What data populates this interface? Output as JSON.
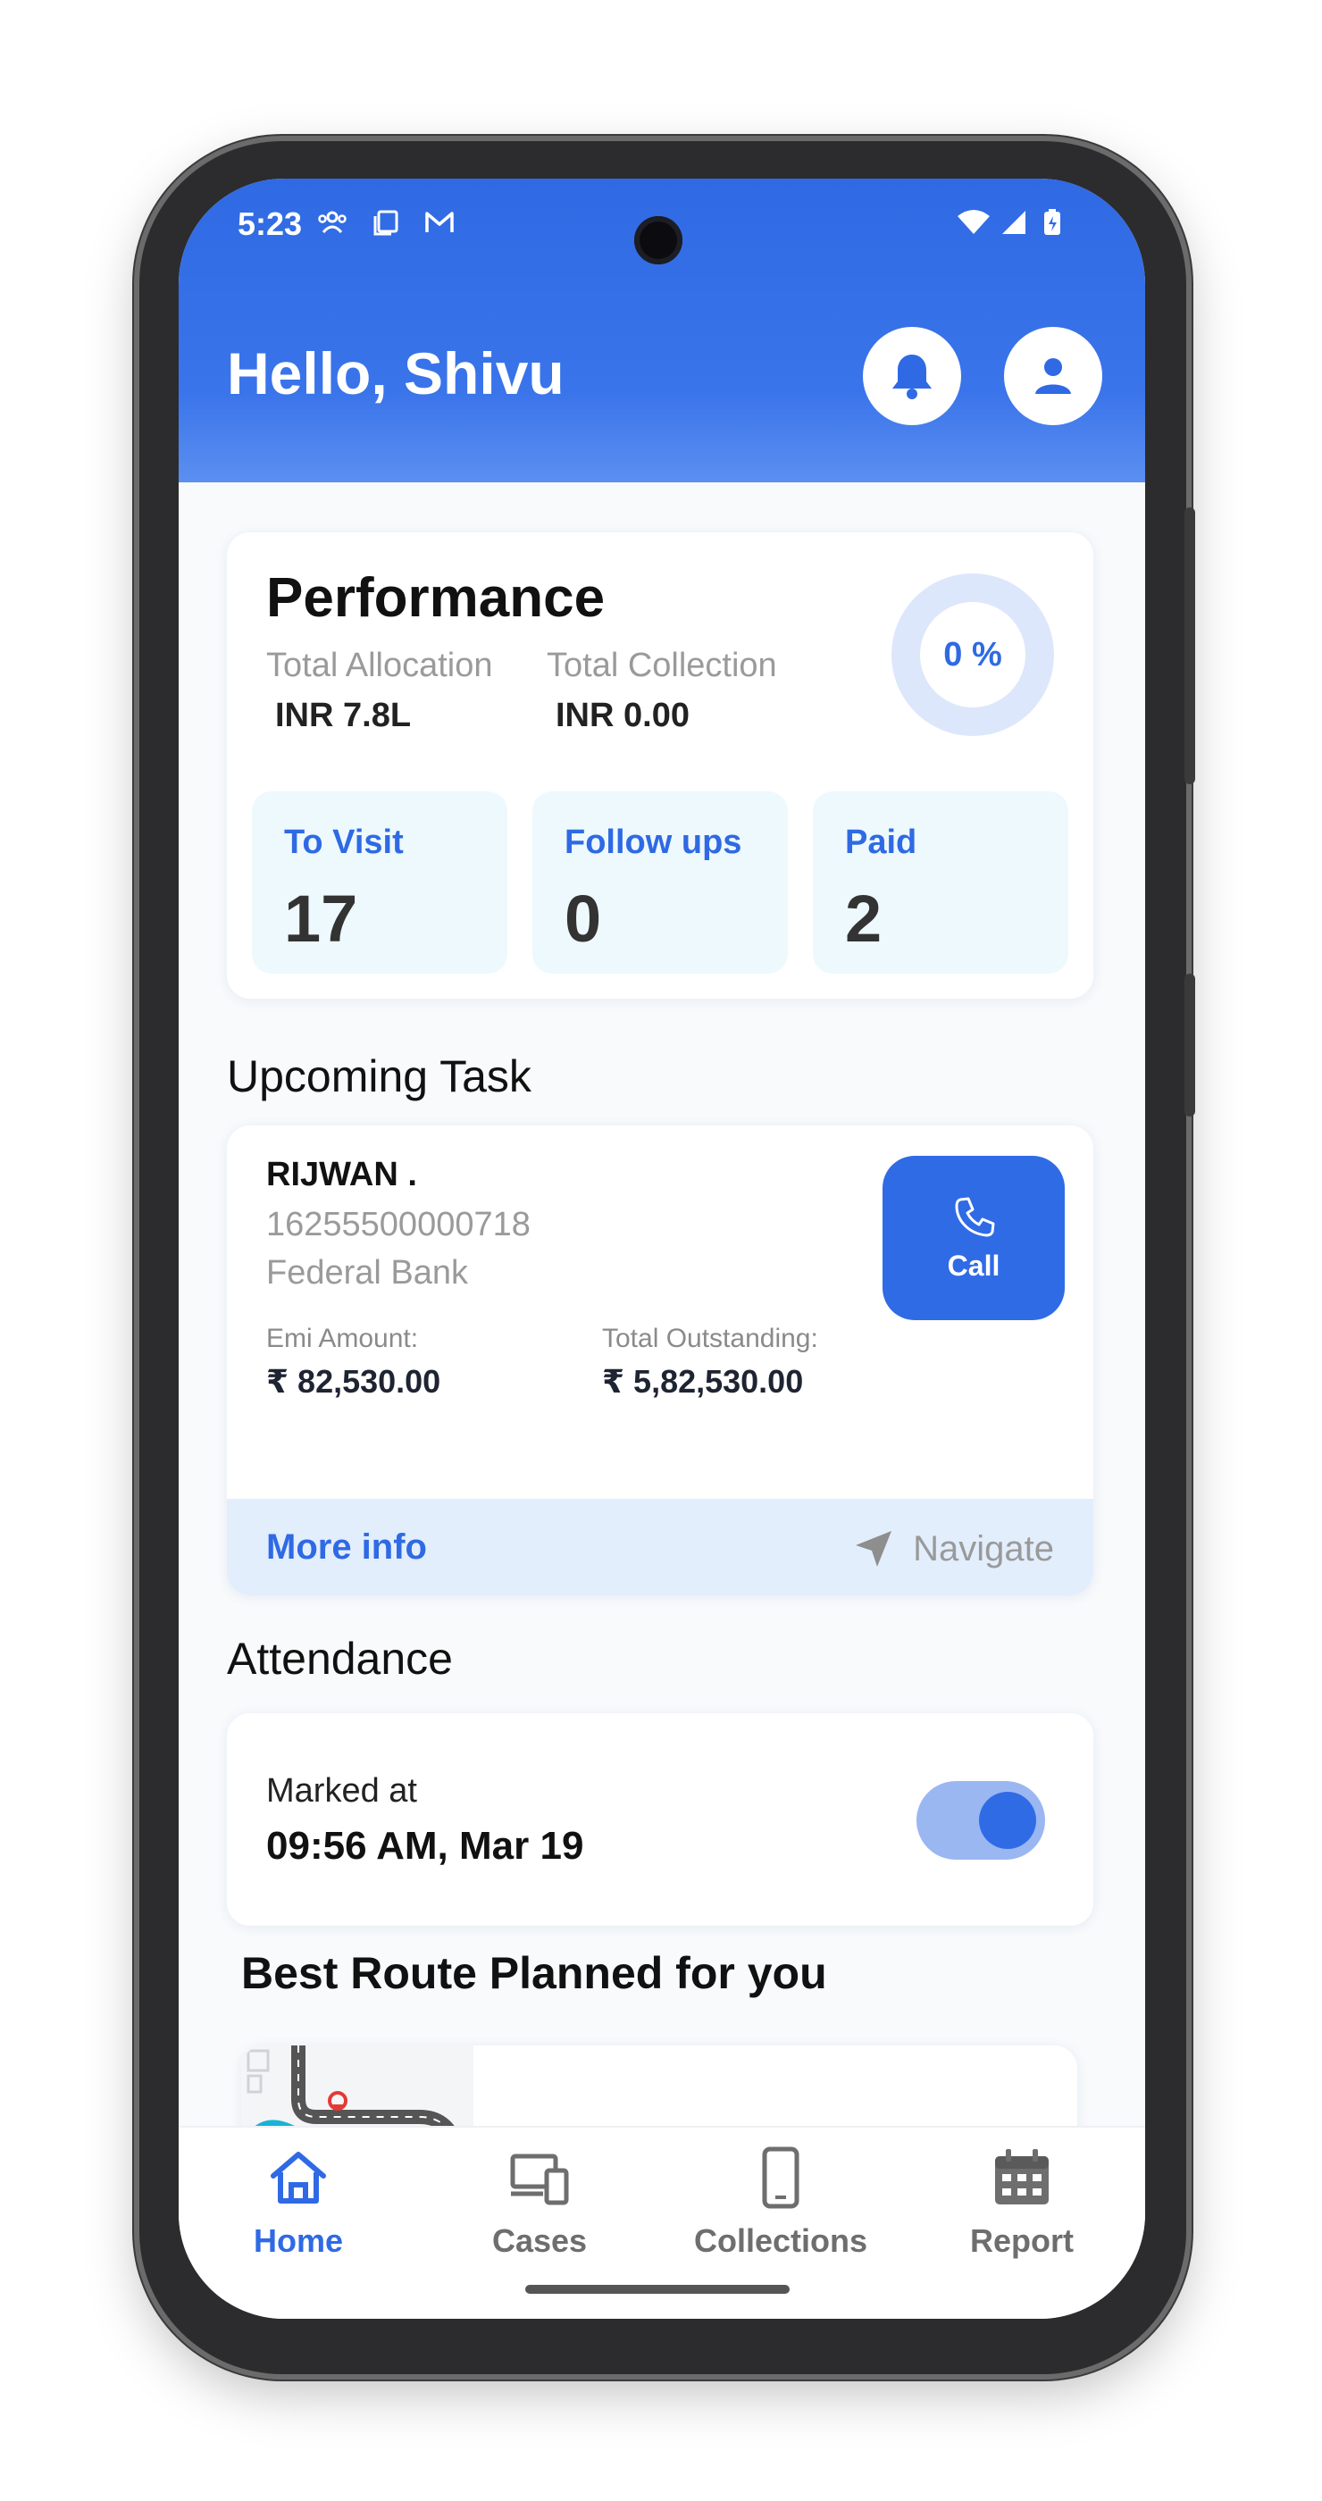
{
  "status_bar": {
    "time": "5:23"
  },
  "header": {
    "greeting": "Hello, Shivu"
  },
  "performance": {
    "title": "Performance",
    "total_allocation_label": "Total Allocation",
    "total_allocation_value": "INR 7.8L",
    "total_collection_label": "Total Collection",
    "total_collection_value": "INR 0.00",
    "progress_label": "0 %",
    "progress_percent": 0,
    "stats": [
      {
        "label": "To Visit",
        "value": "17"
      },
      {
        "label": "Follow ups",
        "value": "0"
      },
      {
        "label": "Paid",
        "value": "2"
      }
    ]
  },
  "upcoming_task": {
    "section_title": "Upcoming Task",
    "name": "RIJWAN .",
    "account_number": "16255500000718",
    "bank": "Federal Bank",
    "emi_label": "Emi Amount:",
    "emi_value": "₹ 82,530.00",
    "outstanding_label": "Total Outstanding:",
    "outstanding_value": "₹ 5,82,530.00",
    "call_label": "Call",
    "more_info_label": "More info",
    "navigate_label": "Navigate"
  },
  "attendance": {
    "section_title": "Attendance",
    "marked_label": "Marked at",
    "marked_time": "09:56 AM, Mar 19",
    "toggle_on": true
  },
  "route": {
    "section_title": "Best Route Planned for you"
  },
  "bottom_nav": {
    "items": [
      {
        "label": "Home",
        "icon": "home-icon",
        "active": true
      },
      {
        "label": "Cases",
        "icon": "devices-icon",
        "active": false
      },
      {
        "label": "Collections",
        "icon": "phone-icon",
        "active": false
      },
      {
        "label": "Report",
        "icon": "calendar-icon",
        "active": false
      }
    ]
  },
  "colors": {
    "primary": "#306be6",
    "stat_bg": "#eef9fd",
    "footer_bg": "#e3eefd"
  }
}
